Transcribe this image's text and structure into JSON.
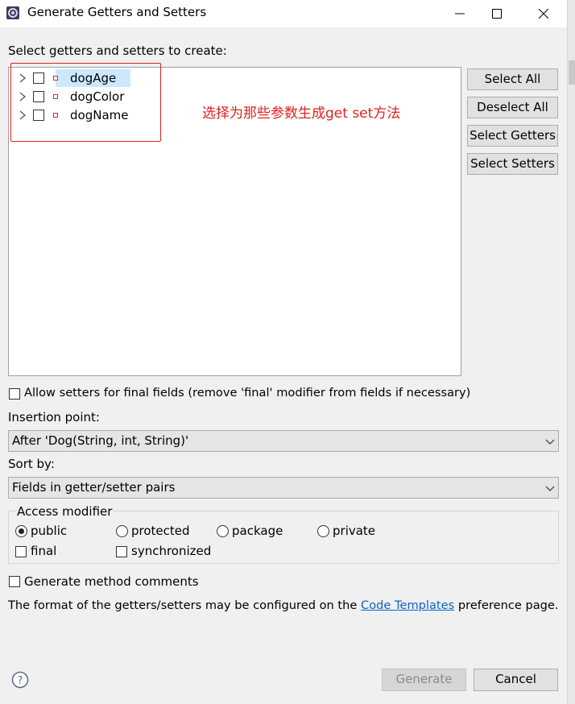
{
  "window": {
    "title": "Generate Getters and Setters",
    "minimize_icon": "minimize-icon",
    "maximize_icon": "maximize-icon",
    "close_icon": "close-icon"
  },
  "tree": {
    "prompt": "Select getters and setters to create:",
    "items": [
      {
        "label": "dogAge",
        "checked": false,
        "selected": true
      },
      {
        "label": "dogColor",
        "checked": false,
        "selected": false
      },
      {
        "label": "dogName",
        "checked": false,
        "selected": false
      }
    ]
  },
  "annotation": {
    "text": "选择为那些参数生成get  set方法",
    "color": "#e02020"
  },
  "side_buttons": {
    "select_all": "Select All",
    "deselect_all": "Deselect All",
    "select_getters": "Select Getters",
    "select_setters": "Select Setters"
  },
  "allow_setters": {
    "label": "Allow setters for final fields (remove 'final' modifier from fields if necessary)",
    "checked": false
  },
  "insertion_point": {
    "label": "Insertion point:",
    "value": "After 'Dog(String, int, String)'"
  },
  "sort_by": {
    "label": "Sort by:",
    "value": "Fields in getter/setter pairs"
  },
  "access_modifier": {
    "legend": "Access modifier",
    "options": [
      {
        "label": "public",
        "checked": true
      },
      {
        "label": "protected",
        "checked": false
      },
      {
        "label": "package",
        "checked": false
      },
      {
        "label": "private",
        "checked": false
      }
    ],
    "final": {
      "label": "final",
      "checked": false
    },
    "synchronized": {
      "label": "synchronized",
      "checked": false
    }
  },
  "generate_comments": {
    "label": "Generate method comments",
    "checked": false
  },
  "format_note": {
    "prefix": "The format of the getters/setters may be configured on the ",
    "link": "Code Templates",
    "suffix": " preference page."
  },
  "footer": {
    "help_icon": "help-icon",
    "generate": "Generate",
    "cancel": "Cancel"
  },
  "colors": {
    "accent": "#0a64c8",
    "selection": "#cce8ff",
    "annotation": "#e02020"
  }
}
